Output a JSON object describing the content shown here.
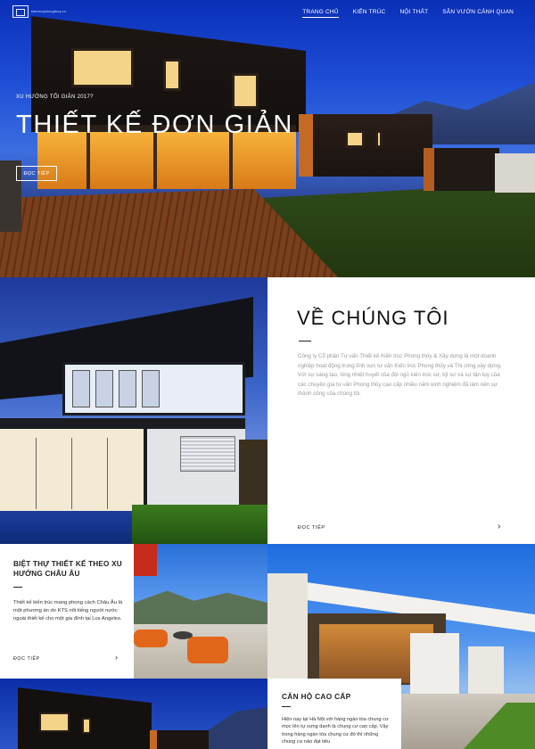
{
  "header": {
    "logo_text": "kientrucphongthuy.vn",
    "nav": [
      {
        "label": "TRANG CHỦ",
        "active": true
      },
      {
        "label": "KIẾN TRÚC",
        "active": false
      },
      {
        "label": "NỘI THẤT",
        "active": false
      },
      {
        "label": "SÂN VƯỜN CẢNH QUAN",
        "active": false
      }
    ]
  },
  "hero": {
    "kicker": "XU HƯỚNG TỐI GIẢN 2017?",
    "title": "THIẾT KẾ ĐƠN GIẢN",
    "button": "ĐỌC TIẾP"
  },
  "about": {
    "title": "VỀ CHÚNG TÔI",
    "body": "Công ty Cổ phần Tư vấn Thiết kế Kiến trúc Phong thủy & Xây dựng là một doanh nghiệp hoạt động trong lĩnh vực tư vấn Kiến trúc Phong thủy và Thi công xây dựng. Với sự sáng tạo, lòng nhiệt huyết của đội ngũ kiến trúc sư, kỹ sư và sự tận tụy của các chuyên gia tư vấn Phong thủy cao cấp nhiều năm kinh nghiệm đã làm nên sự thành công của chúng tôi.",
    "more": "ĐỌC TIẾP",
    "arrow": "›"
  },
  "villa": {
    "title": "BIỆT THỰ THIẾT KẾ THEO XU HƯỚNG CHÂU ÂU",
    "body": "Thiết kế kiến trúc mang phong cách Châu Âu là một phương án do KTS nổi tiếng người nước ngoài thiết kế cho một gia đình tại Los Angeles.",
    "more": "ĐỌC TIẾP",
    "arrow": "›"
  },
  "apartment": {
    "title": "CĂN HỘ CAO CẤP",
    "body": "Hiện nay tại Hà Nội với hàng ngàn tòa chung cư mọc lên tự xưng danh là chung cư cao cấp. Vậy trong hàng ngàn tòa chung cư đó thì những chung cư nào đạt tiêu"
  }
}
